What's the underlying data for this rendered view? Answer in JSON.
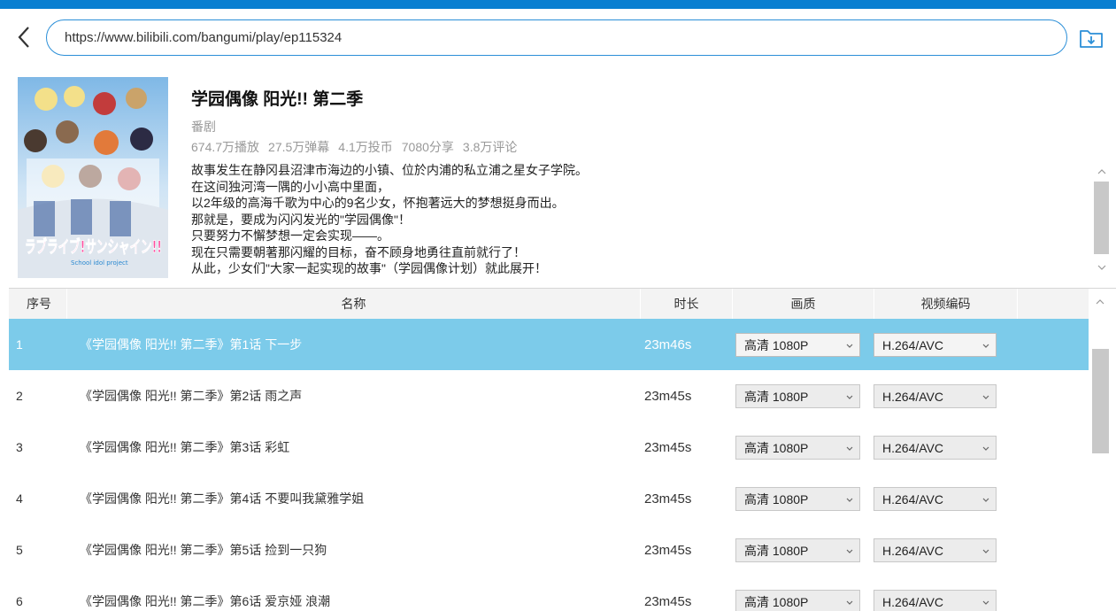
{
  "browser": {
    "url": "https://www.bilibili.com/bangumi/play/ep115324",
    "back_icon": "chevron-left-icon",
    "download_icon": "download-folder-icon"
  },
  "show": {
    "title": "学园偶像 阳光!! 第二季",
    "type": "番剧",
    "stats": [
      "674.7万播放",
      "27.5万弹幕",
      "4.1万投币",
      "7080分享",
      "3.8万评论"
    ],
    "description": [
      "故事发生在静冈县沼津市海边的小镇、位於内浦的私立浦之星女子学院。",
      "在这间独河湾一隅的小小高中里面，",
      "以2年级的高海千歌为中心的9名少女，怀抱著远大的梦想挺身而出。",
      "那就是，要成为闪闪发光的\"学园偶像\"！",
      "只要努力不懈梦想一定会实现——。",
      "现在只需要朝著那闪耀的目标，奋不顾身地勇往直前就行了！",
      "从此，少女们\"大家一起实现的故事\"（学园偶像计划）就此展开！"
    ],
    "cover_logo_text": "ラブライブ!サンシャイン!!",
    "cover_logo_sub": "School idol project"
  },
  "table": {
    "headers": {
      "index": "序号",
      "name": "名称",
      "duration": "时长",
      "quality": "画质",
      "codec": "视频编码"
    },
    "rows": [
      {
        "index": "1",
        "name": "《学园偶像 阳光!! 第二季》第1话 下一步",
        "duration": "23m46s",
        "quality": "高清 1080P",
        "codec": "H.264/AVC",
        "selected": true
      },
      {
        "index": "2",
        "name": "《学园偶像 阳光!! 第二季》第2话 雨之声",
        "duration": "23m45s",
        "quality": "高清 1080P",
        "codec": "H.264/AVC"
      },
      {
        "index": "3",
        "name": "《学园偶像 阳光!! 第二季》第3话 彩虹",
        "duration": "23m45s",
        "quality": "高清 1080P",
        "codec": "H.264/AVC"
      },
      {
        "index": "4",
        "name": "《学园偶像 阳光!! 第二季》第4话 不要叫我黛雅学姐",
        "duration": "23m45s",
        "quality": "高清 1080P",
        "codec": "H.264/AVC"
      },
      {
        "index": "5",
        "name": "《学园偶像 阳光!! 第二季》第5话 捡到一只狗",
        "duration": "23m45s",
        "quality": "高清 1080P",
        "codec": "H.264/AVC"
      },
      {
        "index": "6",
        "name": "《学园偶像 阳光!! 第二季》第6话 爱京娅 浪潮",
        "duration": "23m45s",
        "quality": "高清 1080P",
        "codec": "H.264/AVC"
      }
    ]
  },
  "colors": {
    "accent": "#0a7fd1",
    "selected_row": "#7ccbea",
    "muted_text": "#999999"
  }
}
